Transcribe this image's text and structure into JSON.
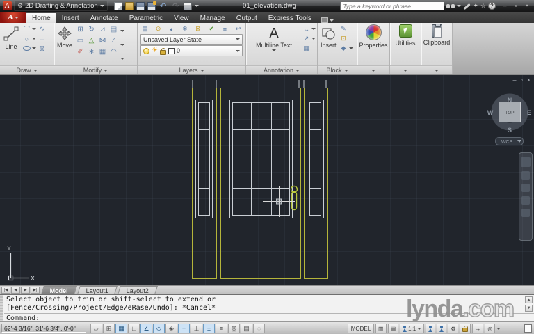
{
  "title_bar": {
    "workspace": "2D Drafting & Annotation",
    "document": "01_elevation.dwg",
    "search_placeholder": "Type a keyword or phrase",
    "app_letter": "A"
  },
  "window_controls": {
    "minimize": "–",
    "restore": "▫",
    "close": "×"
  },
  "ribbon": {
    "tabs": [
      "Home",
      "Insert",
      "Annotate",
      "Parametric",
      "View",
      "Manage",
      "Output",
      "Express Tools"
    ],
    "active_tab": "Home",
    "panels": {
      "draw": {
        "label": "Draw",
        "line": "Line"
      },
      "modify": {
        "label": "Modify",
        "move": "Move"
      },
      "layers": {
        "label": "Layers",
        "layer_state": "Unsaved Layer State",
        "current_layer": "0"
      },
      "annotation": {
        "label": "Annotation",
        "mtext": "Multiline Text"
      },
      "block": {
        "label": "Block",
        "insert": "Insert"
      },
      "properties": {
        "label": "Properties"
      },
      "utilities": {
        "label": "Utilities"
      },
      "clipboard": {
        "label": "Clipboard"
      }
    }
  },
  "icons": {
    "undo": "↶",
    "redo": "↷",
    "gear": "⚙",
    "star": "☆",
    "satellite": "✦",
    "help": "?",
    "arc": "⌒",
    "circle": "○",
    "polyline": "∿",
    "rectangle": "▭",
    "hatch": "▨",
    "copy": "⊞",
    "rotate": "↻",
    "scale": "⊿",
    "stack": "▤",
    "stretch": "▭",
    "offset": "△",
    "mirror": "⋈",
    "trim": "⁄",
    "erase": "✐",
    "explode": "∗",
    "array": "▦",
    "fillet": "◠",
    "layer_props": "▤",
    "layer_off": "⊙",
    "layer_isolate": "◐",
    "layer_freeze": "❄",
    "layer_lock": "⊠",
    "layer_current": "✔",
    "layer_match": "≡",
    "layer_prev": "↩",
    "dimension": "↔",
    "leader": "↗",
    "table": "▦",
    "block_edit": "✎",
    "block_create": "⊡",
    "block_attr": "◆",
    "qv_layouts": "▥",
    "qv_drawings": "▤",
    "arrow_right_sm": "→",
    "isolate": "◎"
  },
  "viewcube": {
    "north": "N",
    "south": "S",
    "east": "E",
    "west": "W",
    "face": "TOP",
    "wcs": "WCS"
  },
  "ucs": {
    "x": "X",
    "y": "Y"
  },
  "layout_tabs": {
    "model": "Model",
    "layout1": "Layout1",
    "layout2": "Layout2"
  },
  "command_line": {
    "history_line1": "Select object to trim or shift-select to extend or",
    "history_line2": "[Fence/Crossing/Project/Edge/eRase/Undo]: *Cancel*",
    "prompt": "Command:"
  },
  "status_bar": {
    "coordinates": "62'-4 3/16\", 31'-6 3/4\", 0'-0\"",
    "model_button": "MODEL",
    "annotation_scale": "1:1",
    "toggles": [
      {
        "name": "infer-constraints",
        "glyph": "▱",
        "active": false
      },
      {
        "name": "snap-mode",
        "glyph": "⊞",
        "active": false
      },
      {
        "name": "grid-display",
        "glyph": "▦",
        "active": true
      },
      {
        "name": "ortho-mode",
        "glyph": "∟",
        "active": false
      },
      {
        "name": "polar-tracking",
        "glyph": "∠",
        "active": true
      },
      {
        "name": "object-snap",
        "glyph": "◇",
        "active": true
      },
      {
        "name": "3d-object-snap",
        "glyph": "◈",
        "active": false
      },
      {
        "name": "object-snap-tracking",
        "glyph": "+",
        "active": true
      },
      {
        "name": "dynamic-ucs",
        "glyph": "⊥",
        "active": false
      },
      {
        "name": "dynamic-input",
        "glyph": "±",
        "active": true
      },
      {
        "name": "lineweight",
        "glyph": "≡",
        "active": false
      },
      {
        "name": "transparency",
        "glyph": "▨",
        "active": false
      },
      {
        "name": "quick-properties",
        "glyph": "▤",
        "active": false
      },
      {
        "name": "selection-cycling",
        "glyph": "◌",
        "active": false
      }
    ]
  },
  "watermark": {
    "name": "lynda",
    "tld": ".com"
  },
  "colors": {
    "canvas_bg": "#21252c",
    "frame_yellow": "#b5b53a",
    "glass_white": "#c9ced4",
    "handle_green": "#b9c83a",
    "ribbon_icon_blue": "#5d7ca3"
  }
}
